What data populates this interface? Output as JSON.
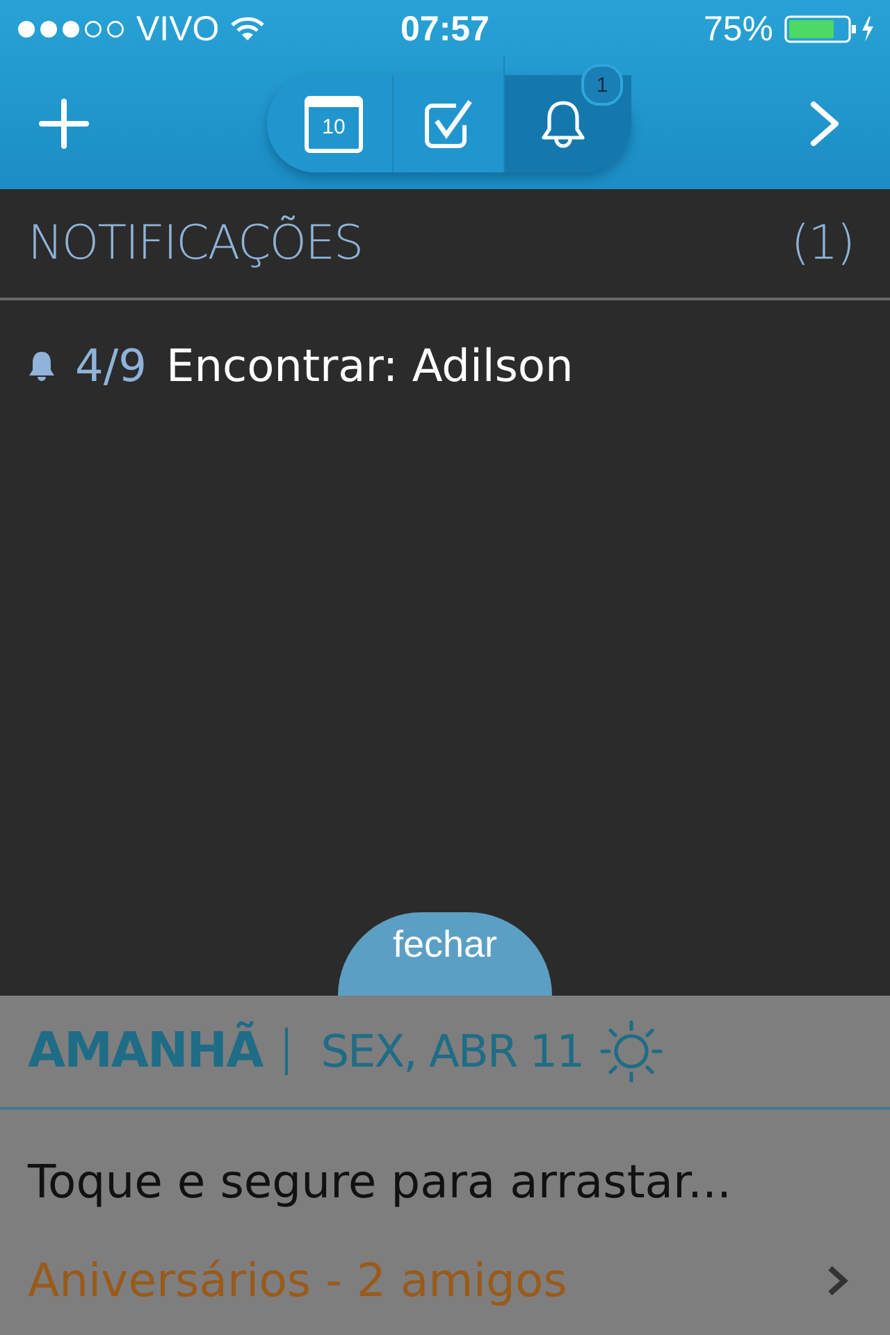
{
  "status_bar": {
    "carrier": "VIVO",
    "time": "07:57",
    "battery": "75%"
  },
  "tabs": [
    {
      "kind": "calendar",
      "label": "10",
      "selected": false
    },
    {
      "kind": "tasks",
      "selected": false
    },
    {
      "kind": "notifications",
      "badge": "1",
      "selected": true
    }
  ],
  "notifications": {
    "title": "NOTIFICAÇÕES",
    "count": "(1)",
    "items": [
      {
        "date": "4/9",
        "text": "Encontrar: Adilson"
      }
    ]
  },
  "close_button": "fechar",
  "day": {
    "title": "AMANHÃ",
    "date": "SEX, ABR 11",
    "hint": "Toque e segure para arrastar...",
    "link": "Aniversários - 2 amigos"
  }
}
